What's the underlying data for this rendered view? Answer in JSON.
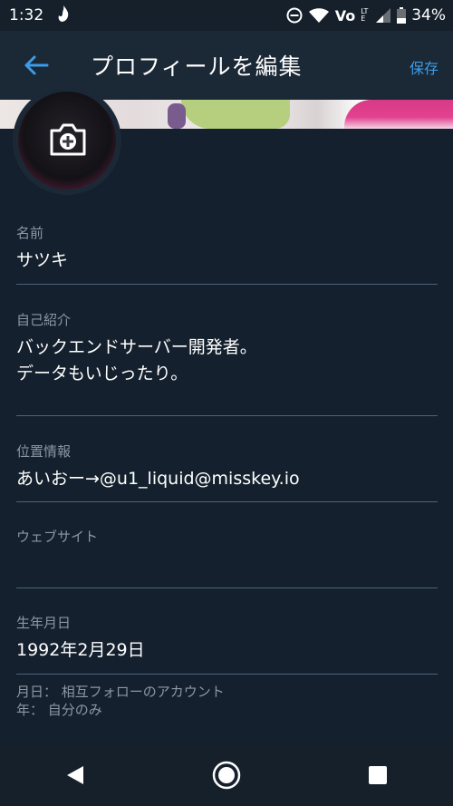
{
  "status_bar": {
    "time": "1:32",
    "carrier": "Vo",
    "network_type": "LTE",
    "battery": "34%"
  },
  "app_bar": {
    "title": "プロフィールを編集",
    "save_label": "保存"
  },
  "profile": {
    "name_label": "名前",
    "name_value": "サツキ",
    "bio_label": "自己紹介",
    "bio_value": "バックエンドサーバー開発者。\nデータもいじったり。",
    "location_label": "位置情報",
    "location_value": "あいおー→@u1_liquid@misskey.io",
    "website_label": "ウェブサイト",
    "website_value": "",
    "birthday_label": "生年月日",
    "birthday_value": "1992年2月29日",
    "birthday_note_monthday": "月日： 相互フォローのアカウント",
    "birthday_note_year": "年： 自分のみ"
  },
  "colors": {
    "accent": "#3c9ce8",
    "background": "#14202d",
    "app_bar": "#1b2836",
    "divider": "#4a6478",
    "label": "#8a97a5"
  },
  "icons": {
    "back": "arrow-left-icon",
    "camera": "camera-plus-icon",
    "nav_back": "triangle-back-icon",
    "nav_home": "circle-home-icon",
    "nav_recents": "square-recents-icon"
  }
}
